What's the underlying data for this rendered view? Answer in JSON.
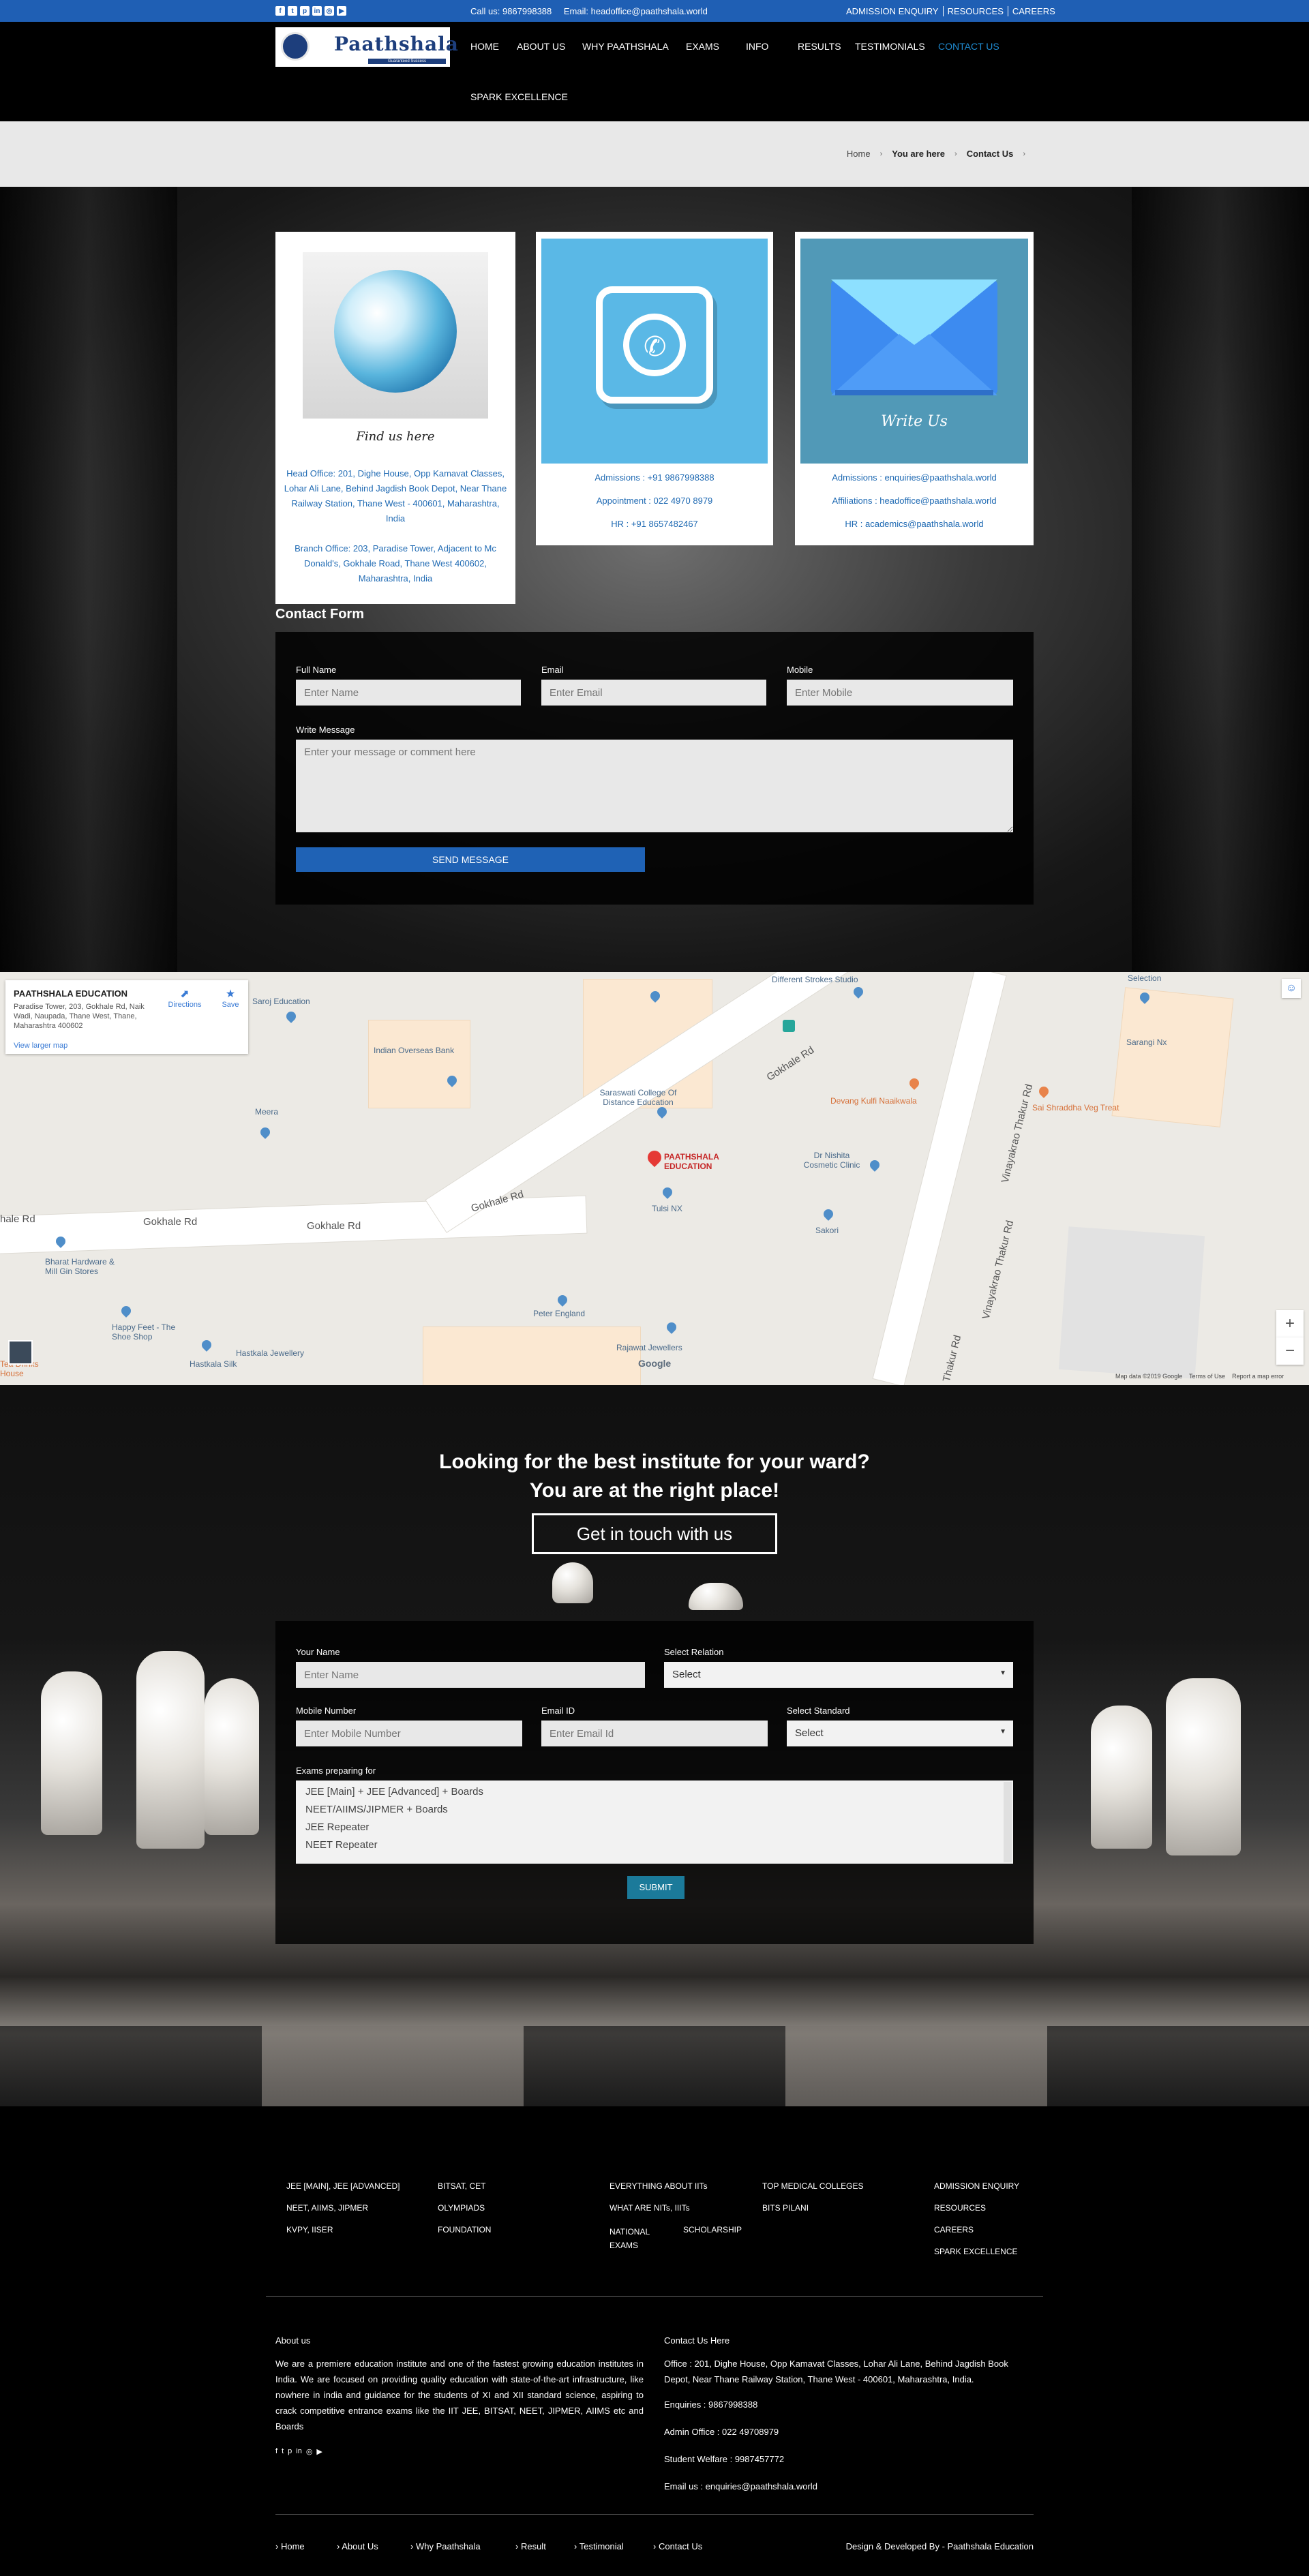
{
  "topbar": {
    "social_icons": [
      "facebook-icon",
      "twitter-icon",
      "pinterest-icon",
      "linkedin-icon",
      "instagram-icon",
      "youtube-icon"
    ],
    "call": "Call us: 9867998388",
    "email": "Email: headoffice@paathshala.world",
    "links": [
      "ADMISSION ENQUIRY",
      "RESOURCES",
      "CAREERS"
    ]
  },
  "header": {
    "logo_text": "Paathshala",
    "logo_tagline": "Guaranteed Success",
    "nav": [
      "HOME",
      "ABOUT US",
      "WHY PAATHSHALA",
      "EXAMS",
      "INFO",
      "RESULTS",
      "TESTIMONIALS",
      "CONTACT US",
      "SPARK EXCELLENCE"
    ],
    "active_nav": "CONTACT US"
  },
  "breadcrumb": {
    "home": "Home",
    "you_are_here": "You are here",
    "current": "Contact Us"
  },
  "cards": {
    "find": {
      "caption": "Find us here",
      "head_office": "Head Office: 201, Dighe House, Opp Kamavat Classes, Lohar Ali Lane, Behind Jagdish Book Depot, Near Thane Railway Station, Thane West - 400601, Maharashtra, India",
      "branch_office": "Branch Office: 203, Paradise Tower, Adjacent to Mc Donald's, Gokhale Road, Thane West 400602, Maharashtra, India"
    },
    "whatsapp": {
      "admissions": "Admissions : +91 9867998388",
      "appointment": "Appointment : 022 4970 8979",
      "hr": "HR : +91 8657482467"
    },
    "write": {
      "caption": "Write Us",
      "admissions": "Admissions : enquiries@paathshala.world",
      "affiliations": "Affiliations : headoffice@paathshala.world",
      "hr": "HR : academics@paathshala.world"
    }
  },
  "contact_form": {
    "title": "Contact Form",
    "full_name_label": "Full Name",
    "full_name_placeholder": "Enter Name",
    "email_label": "Email",
    "email_placeholder": "Enter Email",
    "mobile_label": "Mobile",
    "mobile_placeholder": "Enter Mobile",
    "message_label": "Write Message",
    "message_placeholder": "Enter your message or comment here",
    "submit": "SEND MESSAGE"
  },
  "map": {
    "place_name": "PAATHSHALA EDUCATION",
    "place_address": "Paradise Tower, 203, Gokhale Rd, Naik Wadi, Naupada, Thane West, Thane, Maharashtra 400602",
    "directions": "Directions",
    "save": "Save",
    "view_larger": "View larger map",
    "pin_label": "PAATHSHALA EDUCATION",
    "labels": {
      "different_strokes": "Different Strokes Studio",
      "selection": "Selection",
      "saroj_education": "Saroj Education",
      "indian_overseas": "Indian Overseas Bank",
      "saraswati": "Saraswati College Of Distance Education",
      "sarangi": "Sarangi Nx",
      "devang": "Devang Kulfi Naaikwala",
      "sai_shraddha": "Sai Shraddha Veg Treat",
      "meera": "Meera",
      "dr_nishita": "Dr Nishita Cosmetic Clinic",
      "tulsi": "Tulsi NX",
      "sakori": "Sakori",
      "bharat": "Bharat Hardware & Mill Gin Stores",
      "happy_feet": "Happy Feet - The Shoe Shop",
      "hastkala": "Hastkala Jewellery",
      "hastkala_silk": "Hastkala Silk",
      "peter_england": "Peter England",
      "rajawat": "Rajawat Jewellers",
      "tea": "Tea Drinks House"
    },
    "roads": [
      "Gokhale Rd",
      "Gokhale Rd",
      "Gokhale Rd",
      "Gokhale Rd",
      "Vinayakrao Thakur Rd",
      "Vinayakrao Thakur Rd",
      "Thakur Rd",
      "hale Rd"
    ],
    "footer_data": "Map data ©2019 Google",
    "footer_terms": "Terms of Use",
    "footer_report": "Report a map error",
    "google": "Google",
    "zoom_in": "+",
    "zoom_out": "−"
  },
  "cta": {
    "line1": "Looking for the best institute for your ward?",
    "line2": "You are at the right place!",
    "button": "Get in touch with us"
  },
  "enquiry_form": {
    "name_label": "Your Name",
    "name_placeholder": "Enter Name",
    "relation_label": "Select Relation",
    "relation_value": "Select",
    "mobile_label": "Mobile Number",
    "mobile_placeholder": "Enter Mobile Number",
    "email_label": "Email ID",
    "email_placeholder": "Enter Email Id",
    "standard_label": "Select Standard",
    "standard_value": "Select",
    "exams_label": "Exams preparing for",
    "exams": [
      "JEE [Main] + JEE [Advanced] + Boards",
      "NEET/AIIMS/JIPMER + Boards",
      "JEE Repeater",
      "NEET Repeater"
    ],
    "submit": "SUBMIT"
  },
  "footer": {
    "col1": [
      "JEE [MAIN], JEE [ADVANCED]",
      "NEET, AIIMS, JIPMER",
      "KVPY, IISER"
    ],
    "col2": [
      "BITSAT, CET",
      "OLYMPIADS",
      "FOUNDATION"
    ],
    "col3": [
      "EVERYTHING ABOUT IITs",
      "WHAT ARE NITs, IIITs",
      "NATIONAL EXAMS"
    ],
    "col3b": "SCHOLARSHIP",
    "col4": [
      "TOP MEDICAL COLLEGES",
      "BITS PILANI"
    ],
    "col5": [
      "ADMISSION ENQUIRY",
      "RESOURCES",
      "CAREERS",
      "SPARK EXCELLENCE"
    ],
    "about_title": "About us",
    "about_text": "We are a premiere education institute and one of the fastest growing education institutes in India. We are focused on providing quality education with state-of-the-art infrastructure, like nowhere in india and guidance for the students of XI and XII standard science, aspiring to crack competitive entrance exams like the IIT JEE, BITSAT, NEET, JIPMER, AIIMS etc and Boards",
    "social_icons": [
      "facebook-icon",
      "twitter-icon",
      "pinterest-icon",
      "linkedin-icon",
      "instagram-icon",
      "youtube-icon"
    ],
    "contact_title": "Contact Us Here",
    "office": "Office : 201, Dighe House, Opp Kamavat Classes, Lohar Ali Lane, Behind Jagdish Book Depot, Near Thane Railway Station, Thane West - 400601, Maharashtra, India.",
    "enquiries": "Enquiries : 9867998388",
    "admin_office": "Admin Office : 022 49708979",
    "student_welfare": "Student Welfare : 9987457772",
    "email_us": "Email us : enquiries@paathshala.world",
    "bottom_links": [
      "Home",
      "About Us",
      "Why Paathshala",
      "Result",
      "Testimonial",
      "Contact Us"
    ],
    "credit": "Design & Developed By - Paathshala Education"
  },
  "colors": {
    "brand_blue": "#1f5fb4",
    "link_blue": "#1f6ab3",
    "submit_teal": "#1b7a9a"
  }
}
